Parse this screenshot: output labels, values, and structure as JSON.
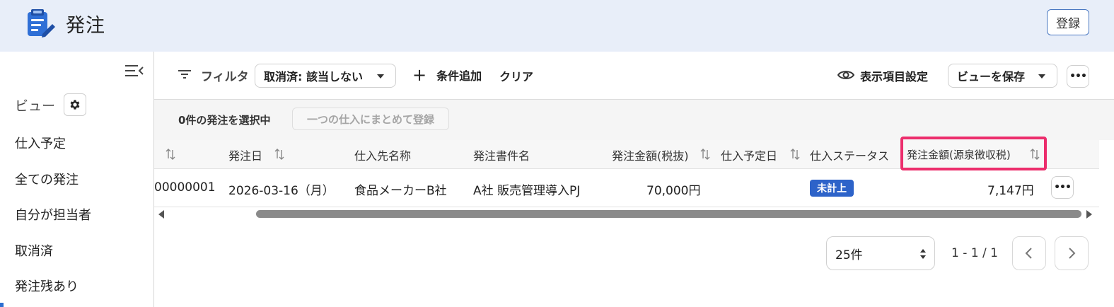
{
  "header": {
    "title": "発注",
    "register_label": "登録",
    "icon": "clipboard-edit-icon"
  },
  "sidebar": {
    "view_label": "ビュー",
    "items": [
      {
        "label": "仕入予定"
      },
      {
        "label": "全ての発注"
      },
      {
        "label": "自分が担当者"
      },
      {
        "label": "取消済"
      },
      {
        "label": "発注残あり"
      }
    ]
  },
  "toolbar": {
    "filter_label": "フィルタ",
    "filter_chip": "取消済: 該当しない",
    "add_condition": "条件追加",
    "clear": "クリア",
    "display_settings": "表示項目設定",
    "save_view": "ビューを保存"
  },
  "selection": {
    "count_text": "0件の発注を選択中",
    "bulk_register": "一つの仕入にまとめて登録"
  },
  "table": {
    "headers": [
      "発注日",
      "仕入先名称",
      "発注書件名",
      "発注金額(税抜)",
      "仕入予定日",
      "仕入ステータス",
      "発注金額(源泉徴収税)"
    ],
    "rows": [
      {
        "id": "00000001",
        "order_date": "2026-03-16（月）",
        "supplier": "食品メーカーB社",
        "subject": "A社 販売管理導入PJ",
        "amount": "70,000円",
        "planned_date": "",
        "status": "未計上",
        "withholding": "7,147円"
      }
    ]
  },
  "pagination": {
    "per_page": "25件",
    "range": "1 - 1 / 1"
  },
  "colors": {
    "header_bg": "#e8eef9",
    "accent": "#2d63c9",
    "highlight": "#ec2d6c"
  }
}
